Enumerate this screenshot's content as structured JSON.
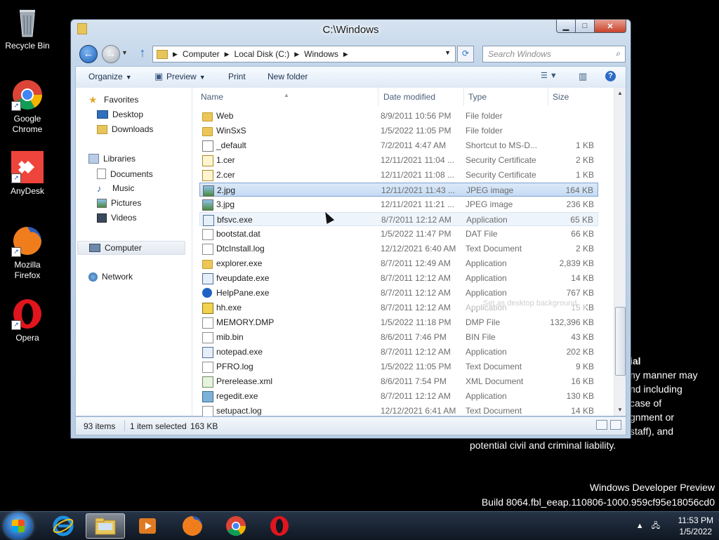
{
  "desktop": {
    "icons": [
      {
        "label": "Recycle Bin",
        "icon": "recycle-bin-icon"
      },
      {
        "label": "Google Chrome",
        "icon": "chrome-icon"
      },
      {
        "label": "AnyDesk",
        "icon": "anydesk-icon"
      },
      {
        "label": "Mozilla Firefox",
        "icon": "firefox-icon"
      },
      {
        "label": "Opera",
        "icon": "opera-icon"
      }
    ],
    "legal_lines": [
      "ial",
      "ny manner may",
      "nd including",
      "case of",
      "gnment or",
      "staff), and",
      "potential civil and criminal liability."
    ],
    "build_lines": [
      "Windows Developer Preview",
      "Build 8064.fbl_eeap.110806-1000.959cf95e18056cd0"
    ]
  },
  "window": {
    "title": "C:\\Windows",
    "breadcrumbs": [
      "Computer",
      "Local Disk (C:)",
      "Windows"
    ],
    "search_placeholder": "Search Windows",
    "toolbar": {
      "organize": "Organize",
      "preview": "Preview",
      "print": "Print",
      "new_folder": "New folder"
    },
    "nav": {
      "favorites": "Favorites",
      "favorites_items": [
        "Desktop",
        "Downloads"
      ],
      "libraries": "Libraries",
      "libraries_items": [
        "Documents",
        "Music",
        "Pictures",
        "Videos"
      ],
      "computer": "Computer",
      "network": "Network"
    },
    "columns": {
      "name": "Name",
      "date": "Date modified",
      "type": "Type",
      "size": "Size"
    },
    "files": [
      {
        "name": "Web",
        "date": "8/9/2011 10:56 PM",
        "type": "File folder",
        "size": "",
        "icon": "folder"
      },
      {
        "name": "WinSxS",
        "date": "1/5/2022 11:05 PM",
        "type": "File folder",
        "size": "",
        "icon": "folder"
      },
      {
        "name": "_default",
        "date": "7/2/2011 4:47 AM",
        "type": "Shortcut to MS-D...",
        "size": "1 KB",
        "icon": "short"
      },
      {
        "name": "1.cer",
        "date": "12/11/2021 11:04 ...",
        "type": "Security Certificate",
        "size": "2 KB",
        "icon": "cert"
      },
      {
        "name": "2.cer",
        "date": "12/11/2021 11:08 ...",
        "type": "Security Certificate",
        "size": "1 KB",
        "icon": "cert"
      },
      {
        "name": "2.jpg",
        "date": "12/11/2021 11:43 ...",
        "type": "JPEG image",
        "size": "164 KB",
        "icon": "img"
      },
      {
        "name": "3.jpg",
        "date": "12/11/2021 11:21 ...",
        "type": "JPEG image",
        "size": "236 KB",
        "icon": "img"
      },
      {
        "name": "bfsvc.exe",
        "date": "8/7/2011 12:12 AM",
        "type": "Application",
        "size": "65 KB",
        "icon": "app"
      },
      {
        "name": "bootstat.dat",
        "date": "1/5/2022 11:47 PM",
        "type": "DAT File",
        "size": "66 KB",
        "icon": "doc"
      },
      {
        "name": "DtcInstall.log",
        "date": "12/12/2021 6:40 AM",
        "type": "Text Document",
        "size": "2 KB",
        "icon": "doc"
      },
      {
        "name": "explorer.exe",
        "date": "8/7/2011 12:49 AM",
        "type": "Application",
        "size": "2,839 KB",
        "icon": "folder"
      },
      {
        "name": "fveupdate.exe",
        "date": "8/7/2011 12:12 AM",
        "type": "Application",
        "size": "14 KB",
        "icon": "app"
      },
      {
        "name": "HelpPane.exe",
        "date": "8/7/2011 12:12 AM",
        "type": "Application",
        "size": "767 KB",
        "icon": "help"
      },
      {
        "name": "hh.exe",
        "date": "8/7/2011 12:12 AM",
        "type": "Application",
        "size": "15 KB",
        "icon": "hh"
      },
      {
        "name": "MEMORY.DMP",
        "date": "1/5/2022 11:18 PM",
        "type": "DMP File",
        "size": "132,396 KB",
        "icon": "doc"
      },
      {
        "name": "mib.bin",
        "date": "8/6/2011 7:46 PM",
        "type": "BIN File",
        "size": "43 KB",
        "icon": "doc"
      },
      {
        "name": "notepad.exe",
        "date": "8/7/2011 12:12 AM",
        "type": "Application",
        "size": "202 KB",
        "icon": "app"
      },
      {
        "name": "PFRO.log",
        "date": "1/5/2022 11:05 PM",
        "type": "Text Document",
        "size": "9 KB",
        "icon": "doc"
      },
      {
        "name": "Prerelease.xml",
        "date": "8/6/2011 7:54 PM",
        "type": "XML Document",
        "size": "16 KB",
        "icon": "xml"
      },
      {
        "name": "regedit.exe",
        "date": "8/7/2011 12:12 AM",
        "type": "Application",
        "size": "130 KB",
        "icon": "reg"
      },
      {
        "name": "setupact.log",
        "date": "12/12/2021 6:41 AM",
        "type": "Text Document",
        "size": "14 KB",
        "icon": "doc"
      }
    ],
    "selected_file": "2.jpg",
    "hovered_file": "bfsvc.exe",
    "drag_tooltip": "Set as desktop background",
    "status": {
      "items": "93 items",
      "selected": "1 item selected",
      "size": "163 KB"
    }
  },
  "taskbar": {
    "apps": [
      "internet-explorer-icon",
      "file-explorer-icon",
      "media-player-icon",
      "firefox-icon",
      "chrome-icon",
      "opera-icon"
    ],
    "time": "11:53 PM",
    "date": "1/5/2022"
  }
}
